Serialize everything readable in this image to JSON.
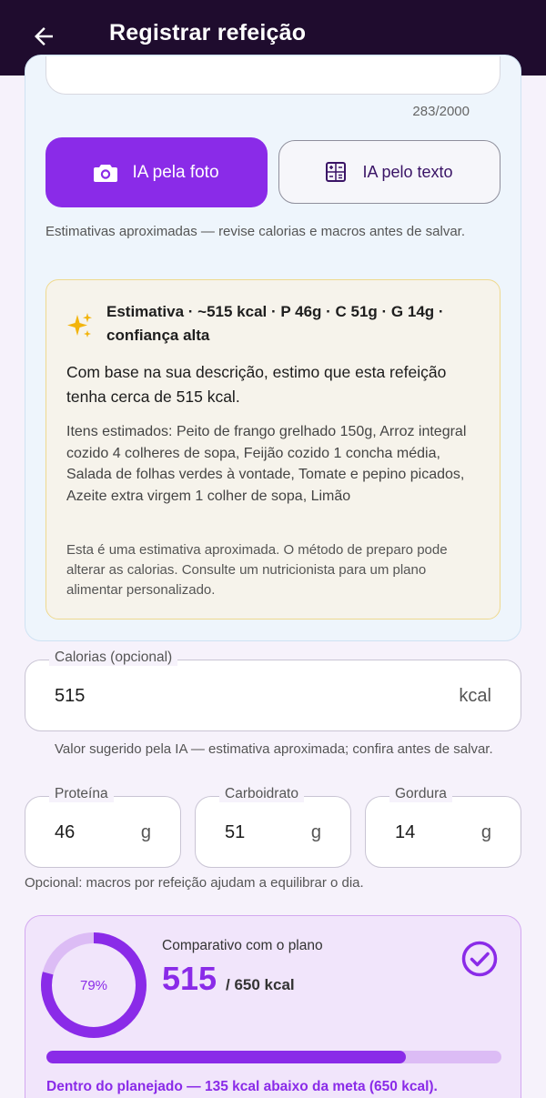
{
  "appbar": {
    "back_icon": "arrow-left-icon",
    "title": "Registrar refeição"
  },
  "description": {
    "counter": "283/2000"
  },
  "ai_buttons": {
    "photo_label": "IA pela foto",
    "photo_icon": "camera-icon",
    "text_label": "IA pelo texto",
    "text_icon": "calculator-icon"
  },
  "disclaimer_top": "Estimativas aproximadas — revise calorias e macros antes de salvar.",
  "estimate": {
    "icon": "sparkle-icon",
    "title": "Estimativa · ~515 kcal · P 46g · C 51g · G 14g · confiança alta",
    "summary": "Com base na sua descrição, estimo que esta refeição tenha cerca de 515 kcal.",
    "items": "Itens estimados: Peito de frango grelhado 150g, Arroz integral cozido 4 colheres de sopa, Feijão cozido 1 concha média, Salada de folhas verdes à vontade, Tomate e pepino picados, Azeite extra virgem 1 colher de sopa, Limão",
    "note": "Esta é uma estimativa aproximada. O método de preparo pode alterar as calorias. Consulte um nutricionista para um plano alimentar personalizado."
  },
  "calories": {
    "label": "Calorias (opcional)",
    "value": "515",
    "suffix": "kcal",
    "helper": "Valor sugerido pela IA — estimativa aproximada; confira antes de salvar."
  },
  "macros": {
    "protein": {
      "label": "Proteína",
      "value": "46",
      "suffix": "g"
    },
    "carbs": {
      "label": "Carboidrato",
      "value": "51",
      "suffix": "g"
    },
    "fat": {
      "label": "Gordura",
      "value": "14",
      "suffix": "g"
    },
    "helper": "Opcional: macros por refeição ajudam a equilibrar o dia."
  },
  "plan": {
    "title": "Comparativo com o plano",
    "percent_label": "79%",
    "percent": 79,
    "value": "515",
    "target": "/ 650 kcal",
    "status_icon": "check-circle-icon",
    "status": "Dentro do planejado — 135 kcal abaixo da meta (650 kcal).",
    "colors": {
      "accent": "#8a2be8",
      "track": "#dcbcf5"
    }
  }
}
